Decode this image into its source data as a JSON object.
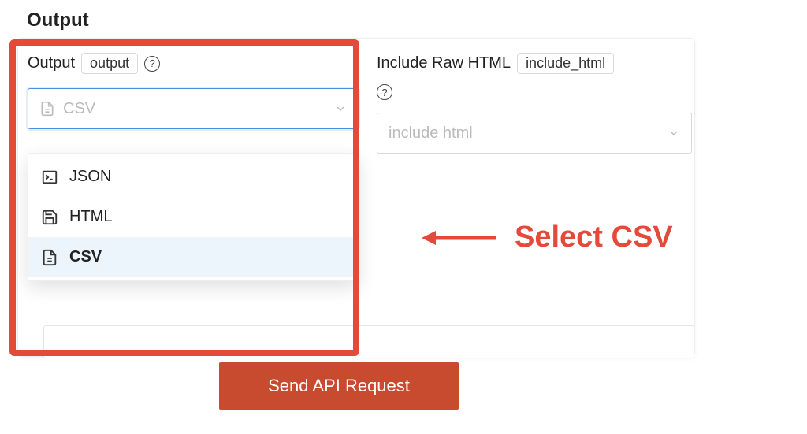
{
  "section_header": "Output",
  "output_field": {
    "label": "Output",
    "param": "output",
    "selected": "CSV",
    "options": [
      "JSON",
      "HTML",
      "CSV"
    ]
  },
  "include_field": {
    "label": "Include Raw HTML",
    "param": "include_html",
    "placeholder": "include html"
  },
  "annotation": "Select CSV",
  "send_button": "Send API Request"
}
